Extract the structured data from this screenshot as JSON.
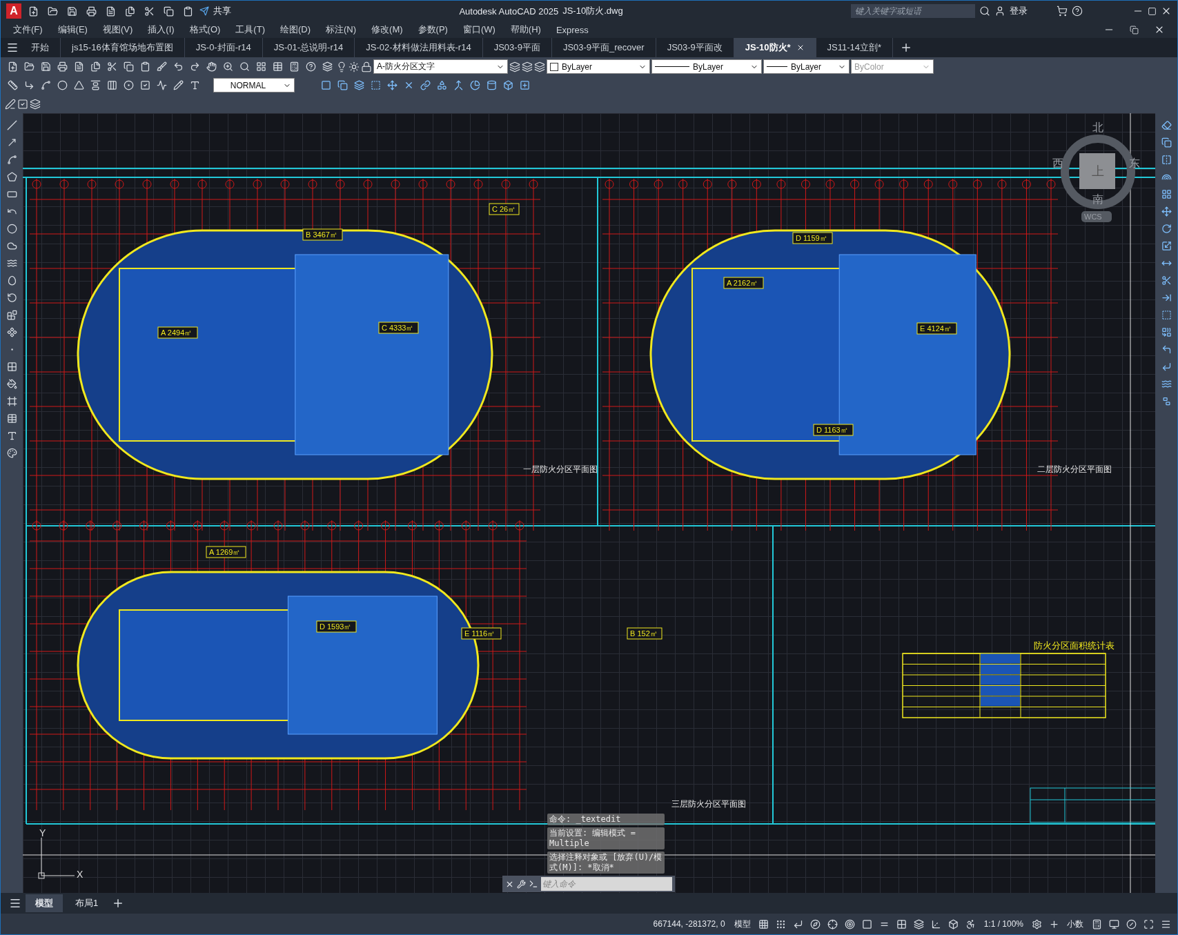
{
  "title_bar": {
    "logo": "A",
    "share": "共享",
    "app_title": "Autodesk AutoCAD 2025",
    "file_name": "JS-10防火.dwg",
    "search_placeholder": "键入关键字或短语",
    "login": "登录"
  },
  "menu": [
    "文件(F)",
    "编辑(E)",
    "视图(V)",
    "插入(I)",
    "格式(O)",
    "工具(T)",
    "绘图(D)",
    "标注(N)",
    "修改(M)",
    "参数(P)",
    "窗口(W)",
    "帮助(H)",
    "Express"
  ],
  "doc_tabs": [
    {
      "label": "开始",
      "selected": false
    },
    {
      "label": "js15-16体育馆场地布置图",
      "selected": false
    },
    {
      "label": "JS-0-封面-r14",
      "selected": false
    },
    {
      "label": "JS-01-总说明-r14",
      "selected": false
    },
    {
      "label": "JS-02-材料做法用料表-r14",
      "selected": false
    },
    {
      "label": "JS03-9平面",
      "selected": false
    },
    {
      "label": "JS03-9平面_recover",
      "selected": false
    },
    {
      "label": "JS03-9平面改",
      "selected": false
    },
    {
      "label": "JS-10防火*",
      "selected": true
    },
    {
      "label": "JS11-14立剖*",
      "selected": false
    }
  ],
  "properties": {
    "layer": "A-防火分区文字",
    "color_mode": "ByLayer",
    "linetype": "ByLayer",
    "lineweight": "ByLayer",
    "plot_style": "ByColor",
    "text_style": "NORMAL"
  },
  "drawing": {
    "plans": [
      {
        "title": "一层防火分区平面图",
        "labels": [
          "B 3467㎡",
          "C 26㎡",
          "A 2494㎡",
          "C 4333㎡"
        ]
      },
      {
        "title": "二层防火分区平面图",
        "labels": [
          "D 1159㎡",
          "A 2162㎡",
          "E 4124㎡",
          "D 1163㎡"
        ]
      },
      {
        "title": "三层防火分区平面图",
        "labels": [
          "A 1269㎡",
          "D 1593㎡",
          "E 1116㎡",
          "B 152㎡"
        ]
      }
    ],
    "table_title": "防火分区面积统计表",
    "compass": {
      "north": "北",
      "south": "南",
      "east": "东",
      "west": "西",
      "top": "上",
      "ucs": "WCS"
    },
    "axis_x": "X",
    "axis_y": "Y"
  },
  "command_history": [
    "命令:  _textedit",
    "当前设置: 编辑模式 = Multiple",
    "选择注释对象或 [放弃(U)/模式(M)]: *取消*"
  ],
  "command_placeholder": "键入命令",
  "layout_tabs": [
    {
      "label": "模型",
      "selected": true
    },
    {
      "label": "布局1",
      "selected": false
    }
  ],
  "status_bar": {
    "coordinates": "667144, -281372, 0",
    "space": "模型",
    "scale": "1:1 / 100%",
    "units": "小数"
  }
}
